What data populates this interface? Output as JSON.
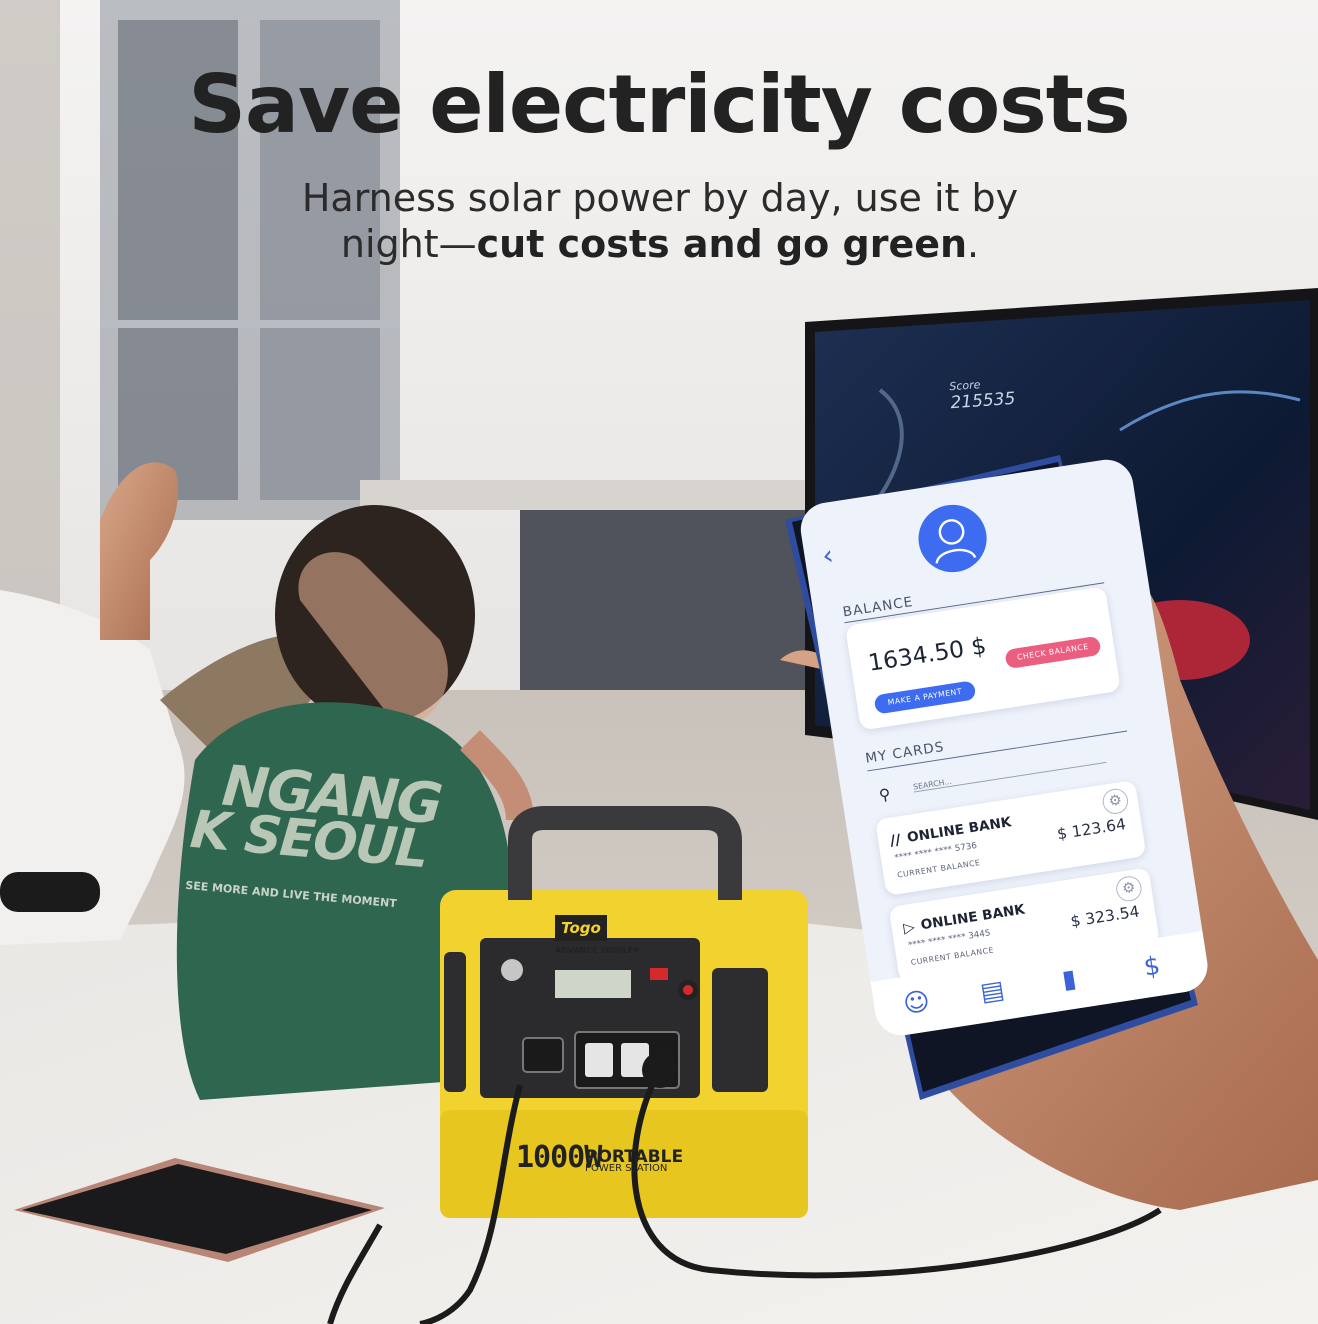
{
  "headline": {
    "title": "Save electricity costs",
    "subtitle_plain": "Harness solar power by day, use it by night—",
    "subtitle_bold": "cut costs and go green",
    "subtitle_end": "."
  },
  "shirt": {
    "line1": "NGANG",
    "line2": "K SEOUL",
    "line3": "SEE MORE AND LIVE THE MOMENT"
  },
  "tv": {
    "score_label": "Score",
    "score_value": "215535"
  },
  "power_station": {
    "brand": "Togo",
    "model": "ADVANCE 1000LFP",
    "capacity": "1000W",
    "label_top": "PORTABLE",
    "label_bottom": "POWER STATION"
  },
  "phone": {
    "balance_title": "BALANCE",
    "balance_amount": "1634.50 $",
    "make_payment": "MAKE A PAYMENT",
    "check_balance": "CHECK BALANCE",
    "cards_title": "MY CARDS",
    "search_placeholder": "SEARCH...",
    "cards": [
      {
        "bank": "ONLINE BANK",
        "number": "**** **** **** 5736",
        "label": "CURRENT BALANCE",
        "amount": "$ 123.64"
      },
      {
        "bank": "ONLINE BANK",
        "number": "**** **** **** 3445",
        "label": "CURRENT BALANCE",
        "amount": "$ 323.54"
      }
    ],
    "nav_icons": [
      "profile-icon",
      "card-icon",
      "stats-icon",
      "dollar-icon"
    ]
  },
  "colors": {
    "station_yellow": "#f2d22e",
    "app_blue": "#3d6cf0",
    "app_pink": "#ec5e80"
  }
}
